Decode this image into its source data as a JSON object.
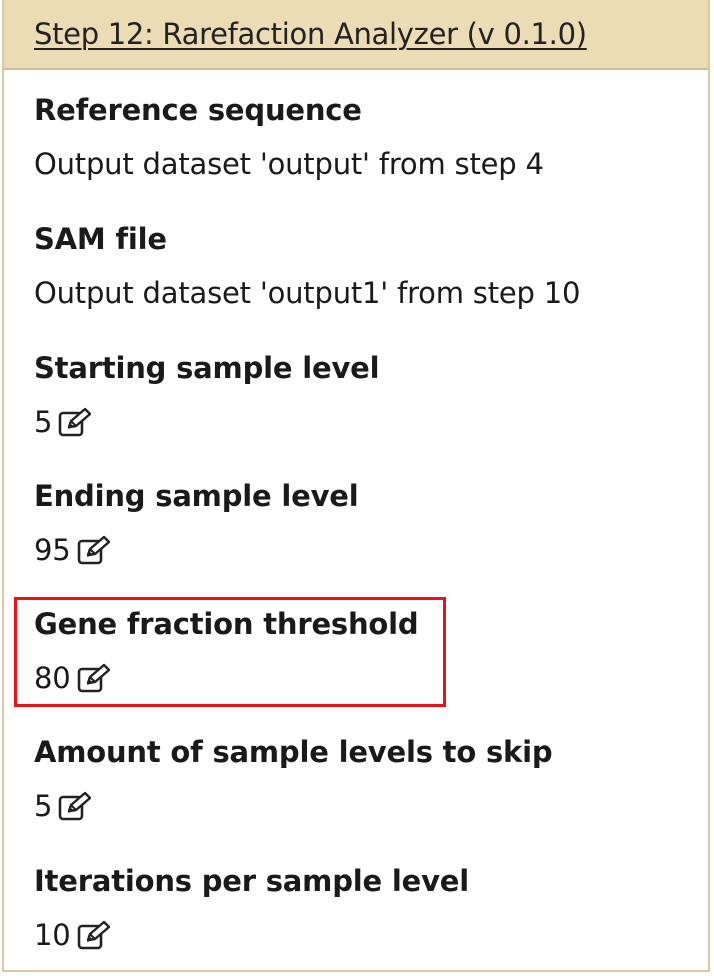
{
  "step_header": {
    "title": "Step 12: Rarefaction Analyzer (v 0.1.0)"
  },
  "fields": [
    {
      "label": "Reference sequence",
      "value": "Output dataset 'output' from step 4",
      "editable": false
    },
    {
      "label": "SAM file",
      "value": "Output dataset 'output1' from step 10",
      "editable": false
    },
    {
      "label": "Starting sample level",
      "value": "5",
      "editable": true
    },
    {
      "label": "Ending sample level",
      "value": "95",
      "editable": true
    },
    {
      "label": "Gene fraction threshold",
      "value": "80",
      "editable": true,
      "highlighted": true
    },
    {
      "label": "Amount of sample levels to skip",
      "value": "5",
      "editable": true
    },
    {
      "label": "Iterations per sample level",
      "value": "10",
      "editable": true
    }
  ],
  "icons": {
    "edit": "pencil-square-edit-icon"
  },
  "colors": {
    "header_bg": "#ebdcb5",
    "border": "#d8c9a2",
    "highlight": "#e8141b"
  }
}
